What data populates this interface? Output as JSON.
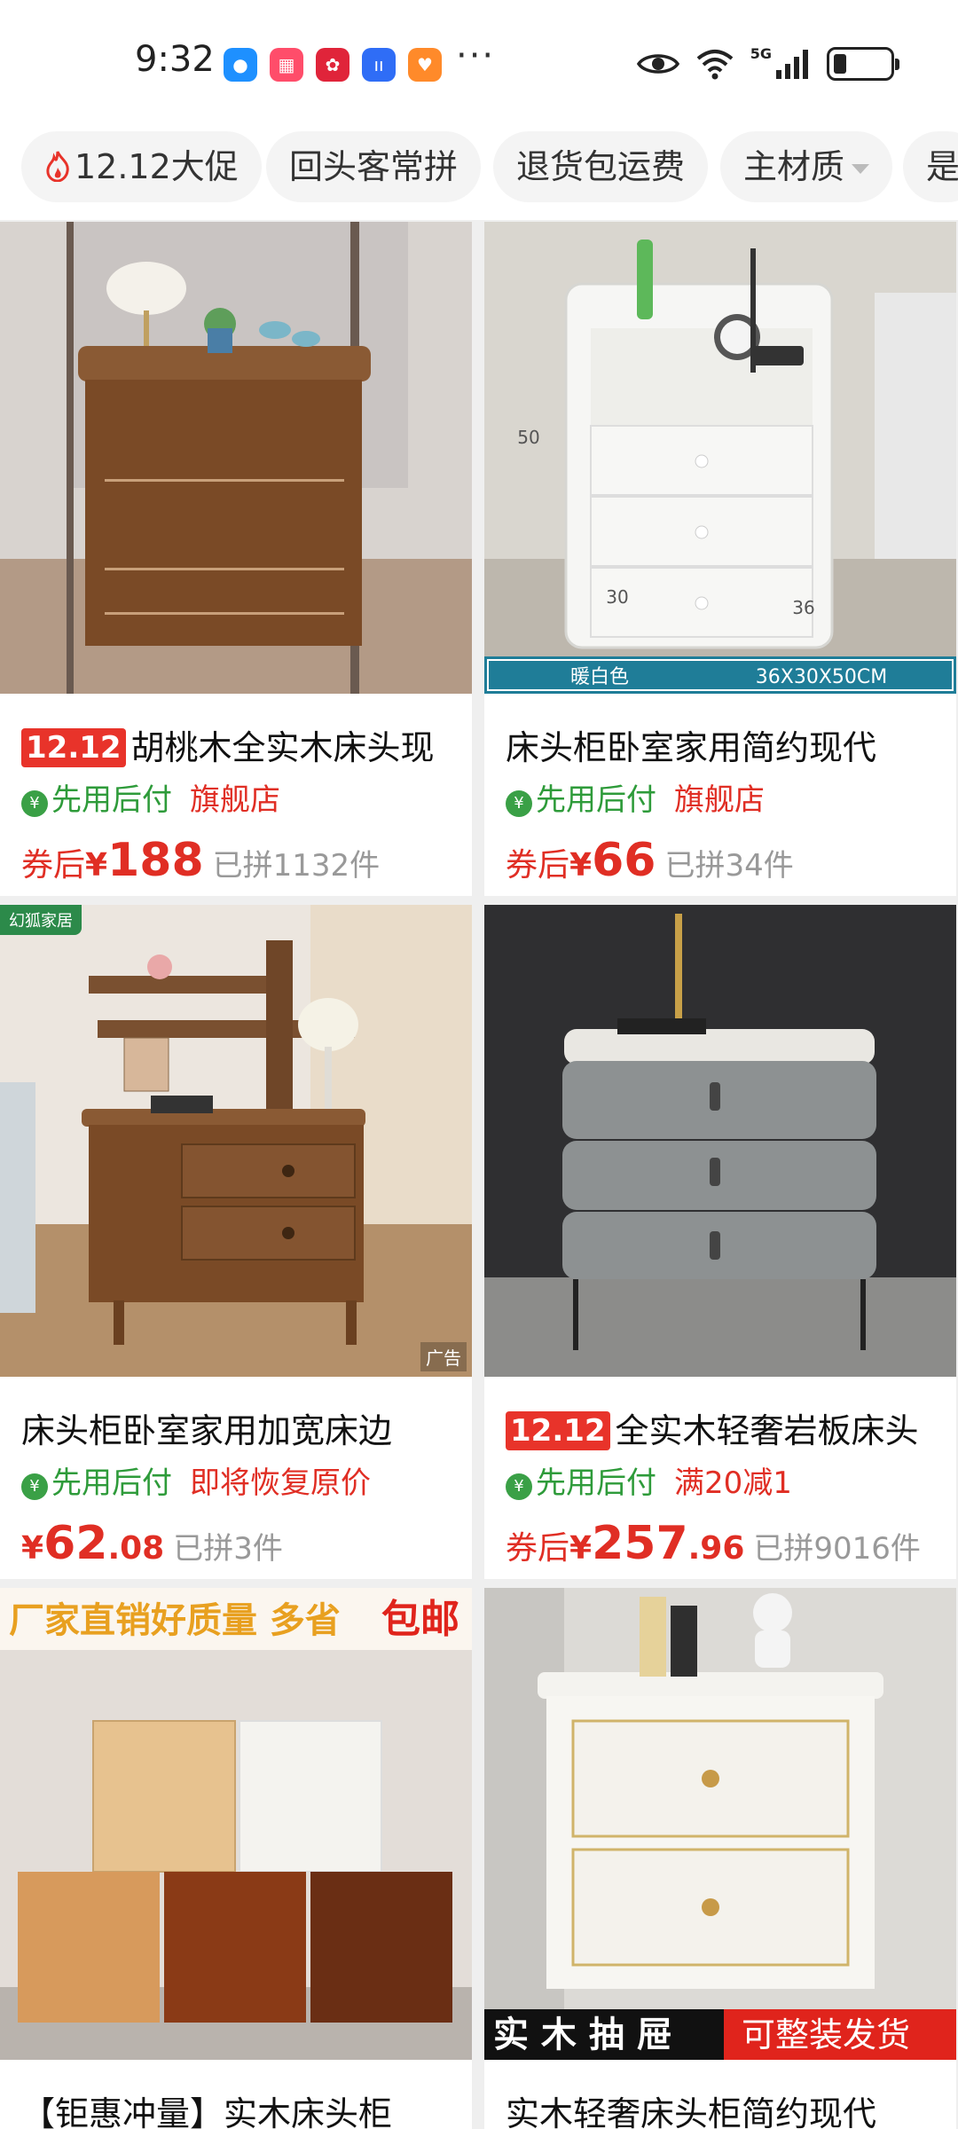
{
  "status_bar": {
    "time": "9:32",
    "network": "5G",
    "notification_icons": [
      "message-icon",
      "app-icon",
      "bear-icon",
      "audio-icon",
      "health-icon"
    ],
    "more": "···"
  },
  "filters": [
    {
      "label": "12.12大促",
      "icon": "flame-icon"
    },
    {
      "label": "回头客常拼"
    },
    {
      "label": "退货包运费"
    },
    {
      "label": "主材质",
      "dropdown": true
    },
    {
      "label": "是"
    }
  ],
  "products": [
    {
      "badge": "12.12",
      "title": "胡桃木全实木床头现",
      "pay_label": "先用后付",
      "tag": "旗舰店",
      "price_prefix": "券后",
      "currency": "¥",
      "price_int": "188",
      "price_dec": "",
      "sold": "已拼1132件"
    },
    {
      "badge": "",
      "title": "床头柜卧室家用简约现代",
      "pay_label": "先用后付",
      "tag": "旗舰店",
      "price_prefix": "券后",
      "currency": "¥",
      "price_int": "66",
      "price_dec": "",
      "sold": "已拼34件",
      "image_text": {
        "color": "暖白色",
        "size": "36X30X50CM",
        "h": "50",
        "d": "30",
        "w": "36"
      }
    },
    {
      "badge": "",
      "title": "床头柜卧室家用加宽床边",
      "pay_label": "先用后付",
      "tag": "即将恢复原价",
      "price_prefix": "",
      "currency": "¥",
      "price_int": "62",
      "price_dec": ".08",
      "sold": "已拼3件",
      "ad_label": "广告",
      "corner_logo": "幻狐家居"
    },
    {
      "badge": "12.12",
      "title": "全实木轻奢岩板床头",
      "pay_label": "先用后付",
      "tag": "满20减1",
      "price_prefix": "券后",
      "currency": "¥",
      "price_int": "257",
      "price_dec": ".96",
      "sold": "已拼9016件"
    },
    {
      "badge": "",
      "title": "【钜惠冲量】实木床头柜",
      "banner_a": "厂家直销好质量 多省",
      "banner_b": "包邮"
    },
    {
      "badge": "",
      "title": "实木轻奢床头柜简约现代",
      "banner_a": "实 木 抽 屉",
      "banner_b": "可整装发货"
    }
  ],
  "colors": {
    "accent_red": "#e02e24",
    "pay_green": "#2e9b3a",
    "background": "#efefef"
  }
}
